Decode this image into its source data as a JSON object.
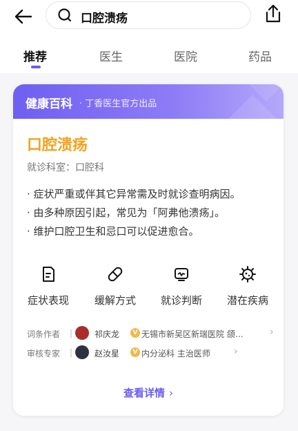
{
  "search": {
    "query": "口腔溃疡"
  },
  "tabs": [
    {
      "label": "推荐",
      "active": true
    },
    {
      "label": "医生",
      "active": false
    },
    {
      "label": "医院",
      "active": false
    },
    {
      "label": "药品",
      "active": false
    }
  ],
  "card": {
    "brand": "健康百科",
    "source": "· 丁香医生官方出品",
    "title": "口腔溃疡",
    "department": "就诊科室：口腔科",
    "bullets": [
      "· 症状严重或伴其它异常需及时就诊查明病因。",
      "· 由多种原因引起，常见为「阿弗他溃疡」。",
      "· 维护口腔卫生和忌口可以促进愈合。"
    ],
    "features": [
      {
        "label": "症状表现",
        "icon": "symptom-icon"
      },
      {
        "label": "缓解方式",
        "icon": "pill-icon"
      },
      {
        "label": "就诊判断",
        "icon": "consult-icon"
      },
      {
        "label": "潜在疾病",
        "icon": "virus-icon"
      }
    ],
    "author": {
      "role": "词条作者",
      "name": "祁庆龙",
      "affiliation": "无锡市新吴区新瑞医院 颌…"
    },
    "reviewer": {
      "role": "审核专家",
      "name": "赵汝星",
      "affiliation": "内分泌科 主治医师"
    },
    "more": "查看详情",
    "accent": "#6b5cf0",
    "title_color": "#f4a11d"
  }
}
